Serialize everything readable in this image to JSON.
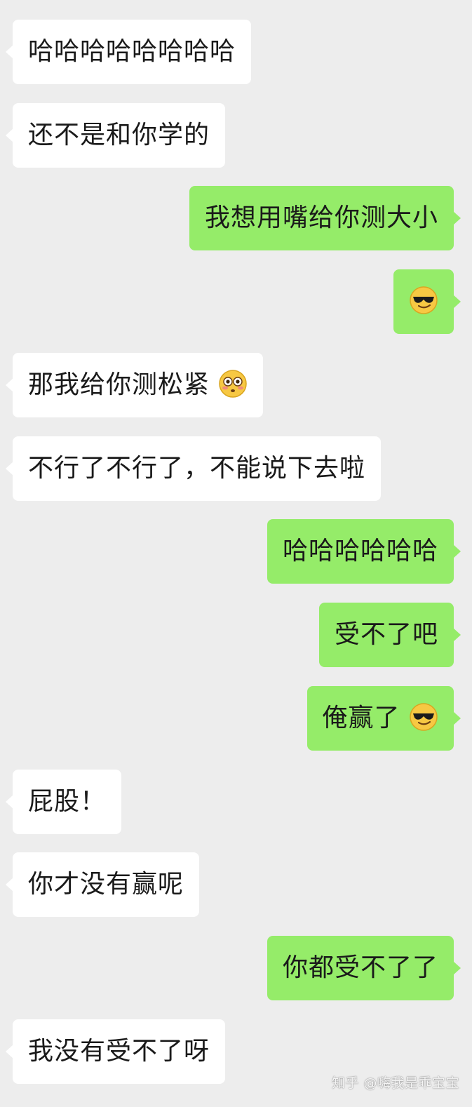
{
  "messages": [
    {
      "side": "in",
      "text": "哈哈哈哈哈哈哈哈",
      "emoji": ""
    },
    {
      "side": "in",
      "text": "还不是和你学的",
      "emoji": ""
    },
    {
      "side": "out",
      "text": "我想用嘴给你测大小",
      "emoji": ""
    },
    {
      "side": "out",
      "text": "",
      "emoji": "smiling-sunglasses-icon"
    },
    {
      "side": "in",
      "text": "那我给你测松紧",
      "emoji": "flushed-face-icon"
    },
    {
      "side": "in",
      "text": "不行了不行了，不能说下去啦",
      "emoji": ""
    },
    {
      "side": "out",
      "text": "哈哈哈哈哈哈",
      "emoji": ""
    },
    {
      "side": "out",
      "text": "受不了吧",
      "emoji": ""
    },
    {
      "side": "out",
      "text": "俺赢了",
      "emoji": "smiling-sunglasses-icon"
    },
    {
      "side": "in",
      "text": "屁股！",
      "emoji": ""
    },
    {
      "side": "in",
      "text": "你才没有赢呢",
      "emoji": ""
    },
    {
      "side": "out",
      "text": "你都受不了了",
      "emoji": ""
    },
    {
      "side": "in",
      "text": "我没有受不了呀",
      "emoji": ""
    }
  ],
  "watermark": "知乎 @嗨我是乖宝宝",
  "colors": {
    "background": "#ededed",
    "incoming_bubble": "#ffffff",
    "outgoing_bubble": "#95ec69",
    "text": "#1a1a1a"
  }
}
